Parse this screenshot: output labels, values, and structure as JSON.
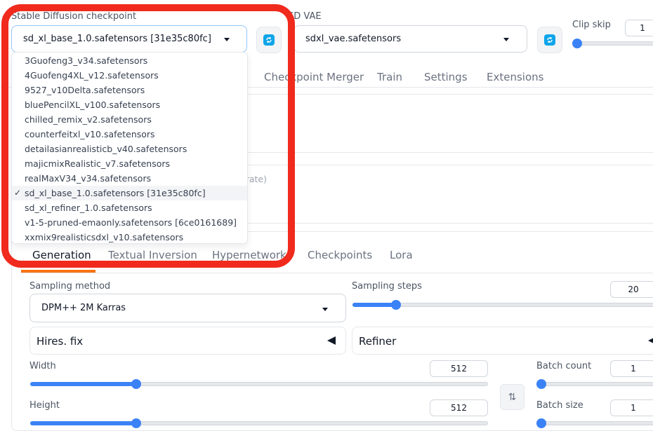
{
  "top": {
    "checkpoint_label": "Stable Diffusion checkpoint",
    "checkpoint_value": "sd_xl_base_1.0.safetensors [31e35c80fc]",
    "vae_label": "SD VAE",
    "vae_value": "sdxl_vae.safetensors",
    "clip_skip_label": "Clip skip",
    "clip_skip_value": "1"
  },
  "dropdown": {
    "options": [
      "3Guofeng3_v34.safetensors",
      "4Guofeng4XL_v12.safetensors",
      "9527_v10Delta.safetensors",
      "bluePencilXL_v100.safetensors",
      "chilled_remix_v2.safetensors",
      "counterfeitxl_v10.safetensors",
      "detailasianrealisticb_v40.safetensors",
      "majicmixRealistic_v7.safetensors",
      "realMaxV34_v34.safetensors",
      "sd_xl_base_1.0.safetensors [31e35c80fc]",
      "sd_xl_refiner_1.0.safetensors",
      "v1-5-pruned-emaonly.safetensors [6ce0161689]",
      "xxmix9realisticsdxl_v10.safetensors"
    ],
    "selected_index": 9,
    "check_glyph": "✓"
  },
  "main_tabs": [
    "Checkpoint Merger",
    "Train",
    "Settings",
    "Extensions"
  ],
  "partial_text": {
    "generate_hint": "erate)"
  },
  "sub_tabs": [
    "Generation",
    "Textual Inversion",
    "Hypernetworks",
    "Checkpoints",
    "Lora"
  ],
  "sampling": {
    "method_label": "Sampling method",
    "method_value": "DPM++ 2M Karras",
    "steps_label": "Sampling steps",
    "steps_value": "20",
    "steps_fraction": 0.13
  },
  "accordions": {
    "hires_label": "Hires. fix",
    "refiner_label": "Refiner"
  },
  "size": {
    "width_label": "Width",
    "width_value": "512",
    "height_label": "Height",
    "height_value": "512",
    "swap_icon": "⇅"
  },
  "batch": {
    "count_label": "Batch count",
    "count_value": "1",
    "size_label": "Batch size",
    "size_value": "1"
  },
  "colors": {
    "accent": "#3b82f6",
    "highlight": "#f02a1d",
    "refresh": "#0ea5e9"
  }
}
